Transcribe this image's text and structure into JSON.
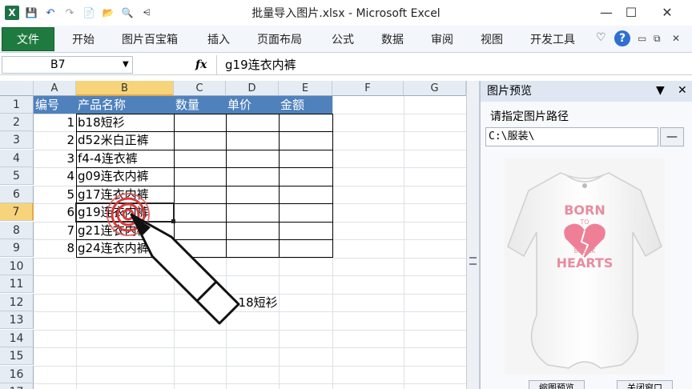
{
  "window": {
    "title": "批量导入图片.xlsx - Microsoft Excel",
    "minimize_glyph": "—",
    "maximize_glyph": "☐",
    "close_glyph": "✕"
  },
  "quick_access": {
    "excel_icon": "X",
    "save_icon": "💾",
    "undo_icon": "↶",
    "redo_icon": "↷",
    "new_icon": "📄",
    "open_icon": "📂",
    "preview_icon": "🔍",
    "customize_icon": "⩤"
  },
  "ribbon": {
    "file_label": "文件",
    "tabs": [
      "开始",
      "图片百宝箱",
      "插入",
      "页面布局",
      "公式",
      "数据",
      "审阅",
      "视图",
      "开发工具"
    ],
    "help_glyph": "?",
    "collapse_glyph": "♡",
    "mini_glyphs": [
      "▭",
      "⧉",
      "✕"
    ]
  },
  "formula_bar": {
    "name_box": "B7",
    "fx_label": "fx",
    "content": "g19连衣内裤"
  },
  "sheet": {
    "columns": [
      "A",
      "B",
      "C",
      "D",
      "E",
      "F",
      "G"
    ],
    "rows": [
      "1",
      "2",
      "3",
      "4",
      "5",
      "6",
      "7",
      "8",
      "9",
      "10",
      "11",
      "12",
      "13",
      "14",
      "15",
      "16",
      "17"
    ],
    "headers": [
      "编号",
      "产品名称",
      "数量",
      "单价",
      "金额"
    ],
    "data": [
      {
        "id": "1",
        "name": "b18短衫"
      },
      {
        "id": "2",
        "name": "d52米白正裤"
      },
      {
        "id": "3",
        "name": "f4-4连衣裤"
      },
      {
        "id": "4",
        "name": "g09连衣内裤"
      },
      {
        "id": "5",
        "name": "g17连衣内裤"
      },
      {
        "id": "6",
        "name": "g19连衣内裤"
      },
      {
        "id": "7",
        "name": "g21连衣内裤"
      },
      {
        "id": "8",
        "name": "g24连衣内裤"
      }
    ],
    "floating_text": "b18短衫"
  },
  "task_pane": {
    "title": "图片预览",
    "dropdown_glyph": "▼",
    "close_glyph": "✕",
    "path_label": "请指定图片路径",
    "path_value": "C:\\服装\\",
    "browse_glyph": "—",
    "preview_text": {
      "line1": "BORN",
      "line2": "TO",
      "line3": "BREAK",
      "line4": "HEARTS"
    },
    "buttons": [
      "缩图预览",
      "关闭窗口"
    ]
  },
  "colors": {
    "file_tab": "#1f7a3f",
    "header_fill": "#4f81bd",
    "selected_header": "#f7d37a",
    "target_red": "#d93a3a"
  }
}
